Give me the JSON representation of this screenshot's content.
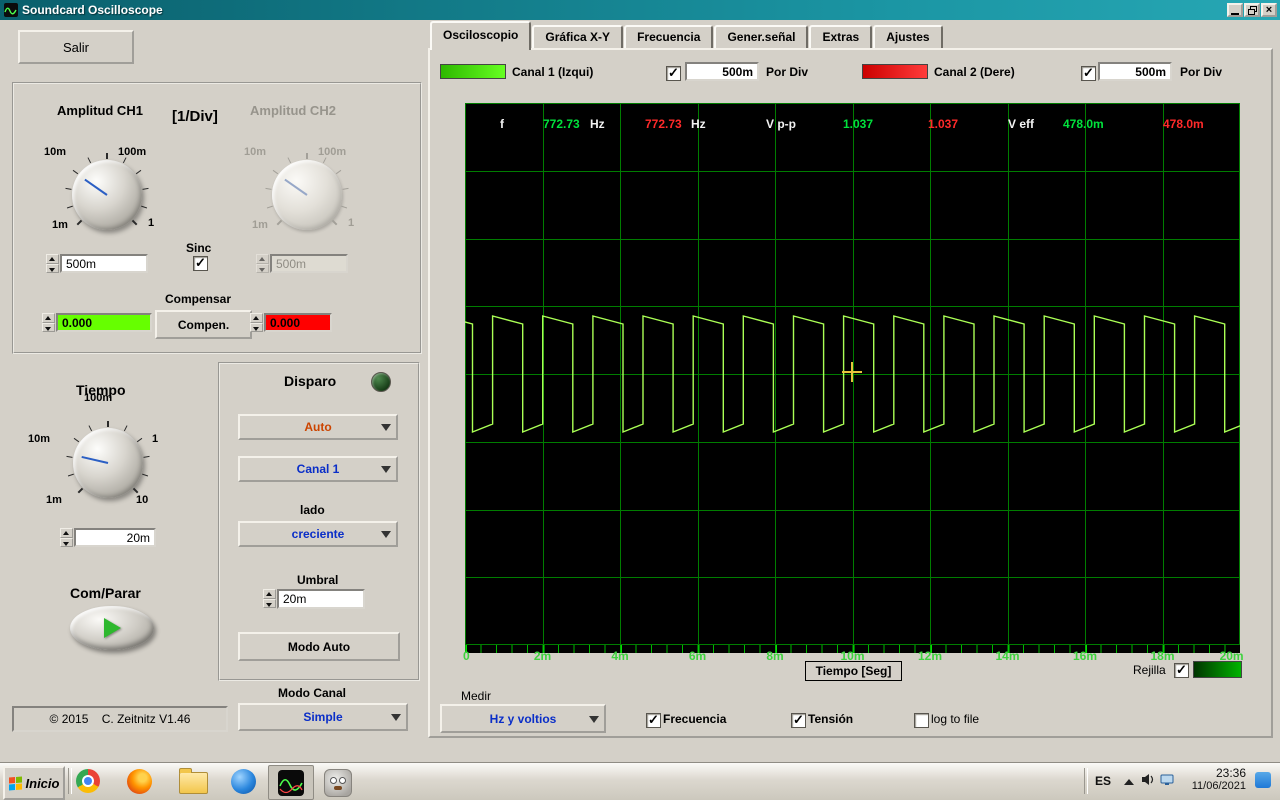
{
  "window": {
    "title": "Soundcard Oscilloscope"
  },
  "icons": {
    "close_glyph": "×"
  },
  "colors": {
    "ch1": "#00e33c",
    "ch2": "#ff2a2a",
    "trace": "#aaff55",
    "grid": "#007d00",
    "offset_green": "#66ff00",
    "offset_red": "#ff0000"
  },
  "left": {
    "salir": "Salir",
    "amp": {
      "ch1_title": "Amplitud CH1",
      "per_div": "[1/Div]",
      "ch2_title": "Amplitud CH2",
      "knob1": {
        "tl": "10m",
        "tr": "100m",
        "bl": "1m",
        "br": "1"
      },
      "knob2": {
        "tl": "10m",
        "tr": "100m",
        "bl": "1m",
        "br": "1"
      },
      "sinc": "Sinc",
      "ch1_value": "500m",
      "ch2_value": "500m",
      "compensar": "Compensar",
      "compen": "Compen.",
      "ch1_offset": "0.000",
      "ch2_offset": "0.000"
    },
    "time": {
      "title": "Tiempo",
      "t": "100m",
      "l": "10m",
      "r": "1",
      "bl": "1m",
      "br": "10",
      "value": "20m"
    },
    "run_title": "Com/Parar",
    "trigger": {
      "title": "Disparo",
      "mode": "Auto",
      "source": "Canal 1",
      "lado": "lado",
      "edge": "creciente",
      "umbral": "Umbral",
      "umbral_value": "20m",
      "modo_auto": "Modo Auto"
    },
    "modo_canal": "Modo Canal",
    "modo_canal_value": "Simple",
    "copyright": "© 2015    C. Zeitnitz V1.46"
  },
  "tabs": {
    "labels": [
      "Osciloscopio",
      "Gráfica X-Y",
      "Frecuencia",
      "Gener.señal",
      "Extras",
      "Ajustes"
    ],
    "active": 0
  },
  "scope": {
    "legend": {
      "ch1": "Canal 1 (Izqui)",
      "ch1_value": "500m",
      "ch2": "Canal 2 (Dere)",
      "ch2_value": "500m",
      "per_div": "Por Div"
    },
    "readout": {
      "f_label": "f",
      "f_ch1": "772.73",
      "f_unit1": "Hz",
      "f_ch2": "772.73",
      "f_unit2": "Hz",
      "vpp_label": "V p-p",
      "vpp_ch1": "1.037",
      "vpp_ch2": "1.037",
      "veff_label": "V eff",
      "veff_ch1": "478.0m",
      "veff_ch2": "478.0m"
    },
    "x_ticks": [
      "0",
      "2m",
      "4m",
      "6m",
      "8m",
      "10m",
      "12m",
      "14m",
      "16m",
      "18m",
      "20m"
    ],
    "x_axis_label": "Tiempo [Seg]",
    "rejilla": "Rejilla",
    "waveform": {
      "type": "square",
      "frequency_hz": 772.73,
      "vpp": 1.037,
      "veff": "478.0m",
      "time_span_s": 0.02,
      "volts_per_div": "500m",
      "duty": 0.6
    }
  },
  "measure": {
    "title": "Medir",
    "mode": "Hz y voltios",
    "frecuencia": "Frecuencia",
    "tension": "Tensión",
    "log": "log to file"
  },
  "taskbar": {
    "start": "Inicio",
    "lang": "ES",
    "time": "23:36",
    "date": "11/06/2021"
  }
}
